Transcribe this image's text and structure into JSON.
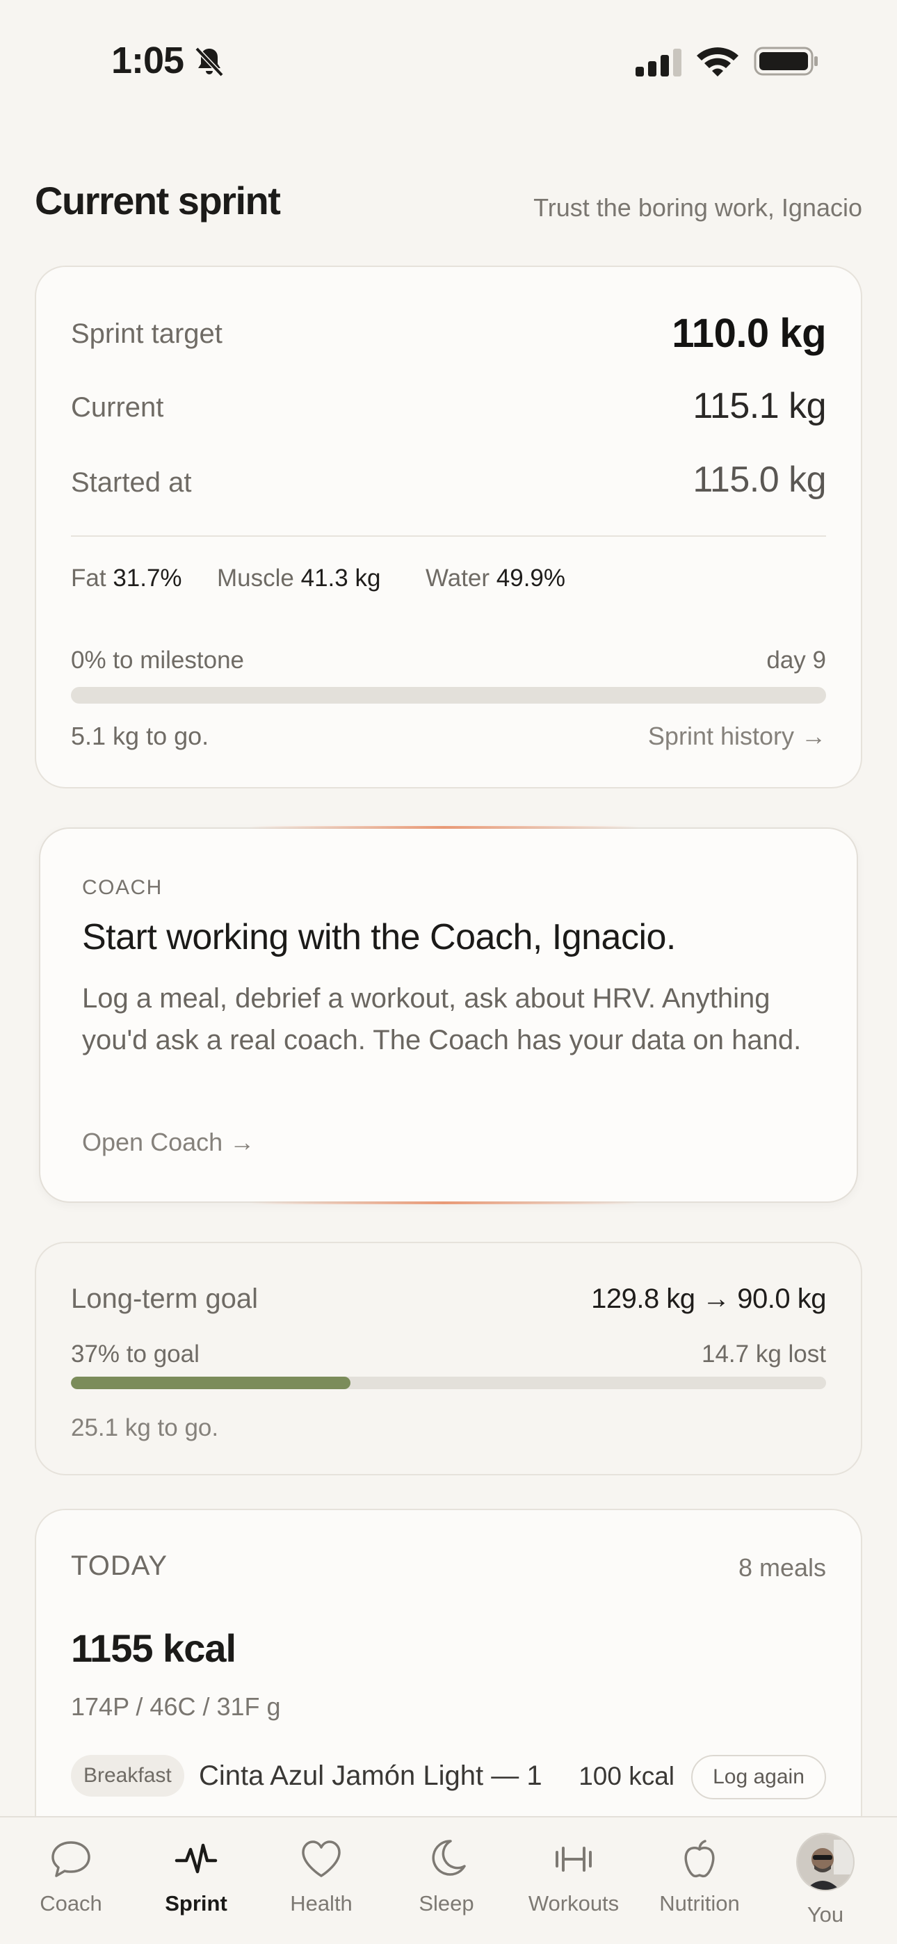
{
  "status_bar": {
    "time": "1:05"
  },
  "header": {
    "title": "Current sprint",
    "subtitle": "Trust the boring work, Ignacio"
  },
  "sprint": {
    "target_label": "Sprint target",
    "target_value": "110.0 kg",
    "current_label": "Current",
    "current_value": "115.1 kg",
    "started_label": "Started at",
    "started_value": "115.0 kg",
    "composition": [
      {
        "label": "Fat",
        "value": "31.7%"
      },
      {
        "label": "Muscle",
        "value": "41.3 kg"
      },
      {
        "label": "Water",
        "value": "49.9%"
      }
    ],
    "milestone_label": "0% to milestone",
    "day_label": "day 9",
    "progress": 0,
    "to_go": "5.1 kg to go.",
    "history_link": "Sprint history →"
  },
  "coach": {
    "eyebrow": "COACH",
    "title": "Start working with the Coach, Ignacio.",
    "body": "Log a meal, debrief a workout, ask about HRV. Anything you'd ask a real coach. The Coach has your data on hand.",
    "link": "Open Coach →"
  },
  "goal": {
    "label": "Long-term goal",
    "range": "129.8 kg → 90.0 kg",
    "percent_label": "37% to goal",
    "lost_label": "14.7 kg lost",
    "progress": 0.37,
    "to_go": "25.1 kg to go."
  },
  "today": {
    "label": "TODAY",
    "meals_count": "8 meals",
    "kcal": "1155 kcal",
    "macros": "174P / 46C / 31F g",
    "meal": {
      "tag": "Breakfast",
      "name": "Cinta Azul Jamón Light — 1 …",
      "kcal": "100 kcal",
      "action": "Log again"
    }
  },
  "tabs": [
    {
      "label": "Coach",
      "icon": "chat-bubble-icon"
    },
    {
      "label": "Sprint",
      "icon": "activity-pulse-icon",
      "active": true
    },
    {
      "label": "Health",
      "icon": "heart-icon"
    },
    {
      "label": "Sleep",
      "icon": "moon-icon"
    },
    {
      "label": "Workouts",
      "icon": "dumbbell-icon"
    },
    {
      "label": "Nutrition",
      "icon": "apple-icon"
    },
    {
      "label": "You",
      "icon": "avatar"
    }
  ],
  "colors": {
    "background": "#f7f5f1",
    "goal_progress": "#7b8c5a",
    "track": "#e3e0da",
    "coach_glow": "#e88c64"
  }
}
